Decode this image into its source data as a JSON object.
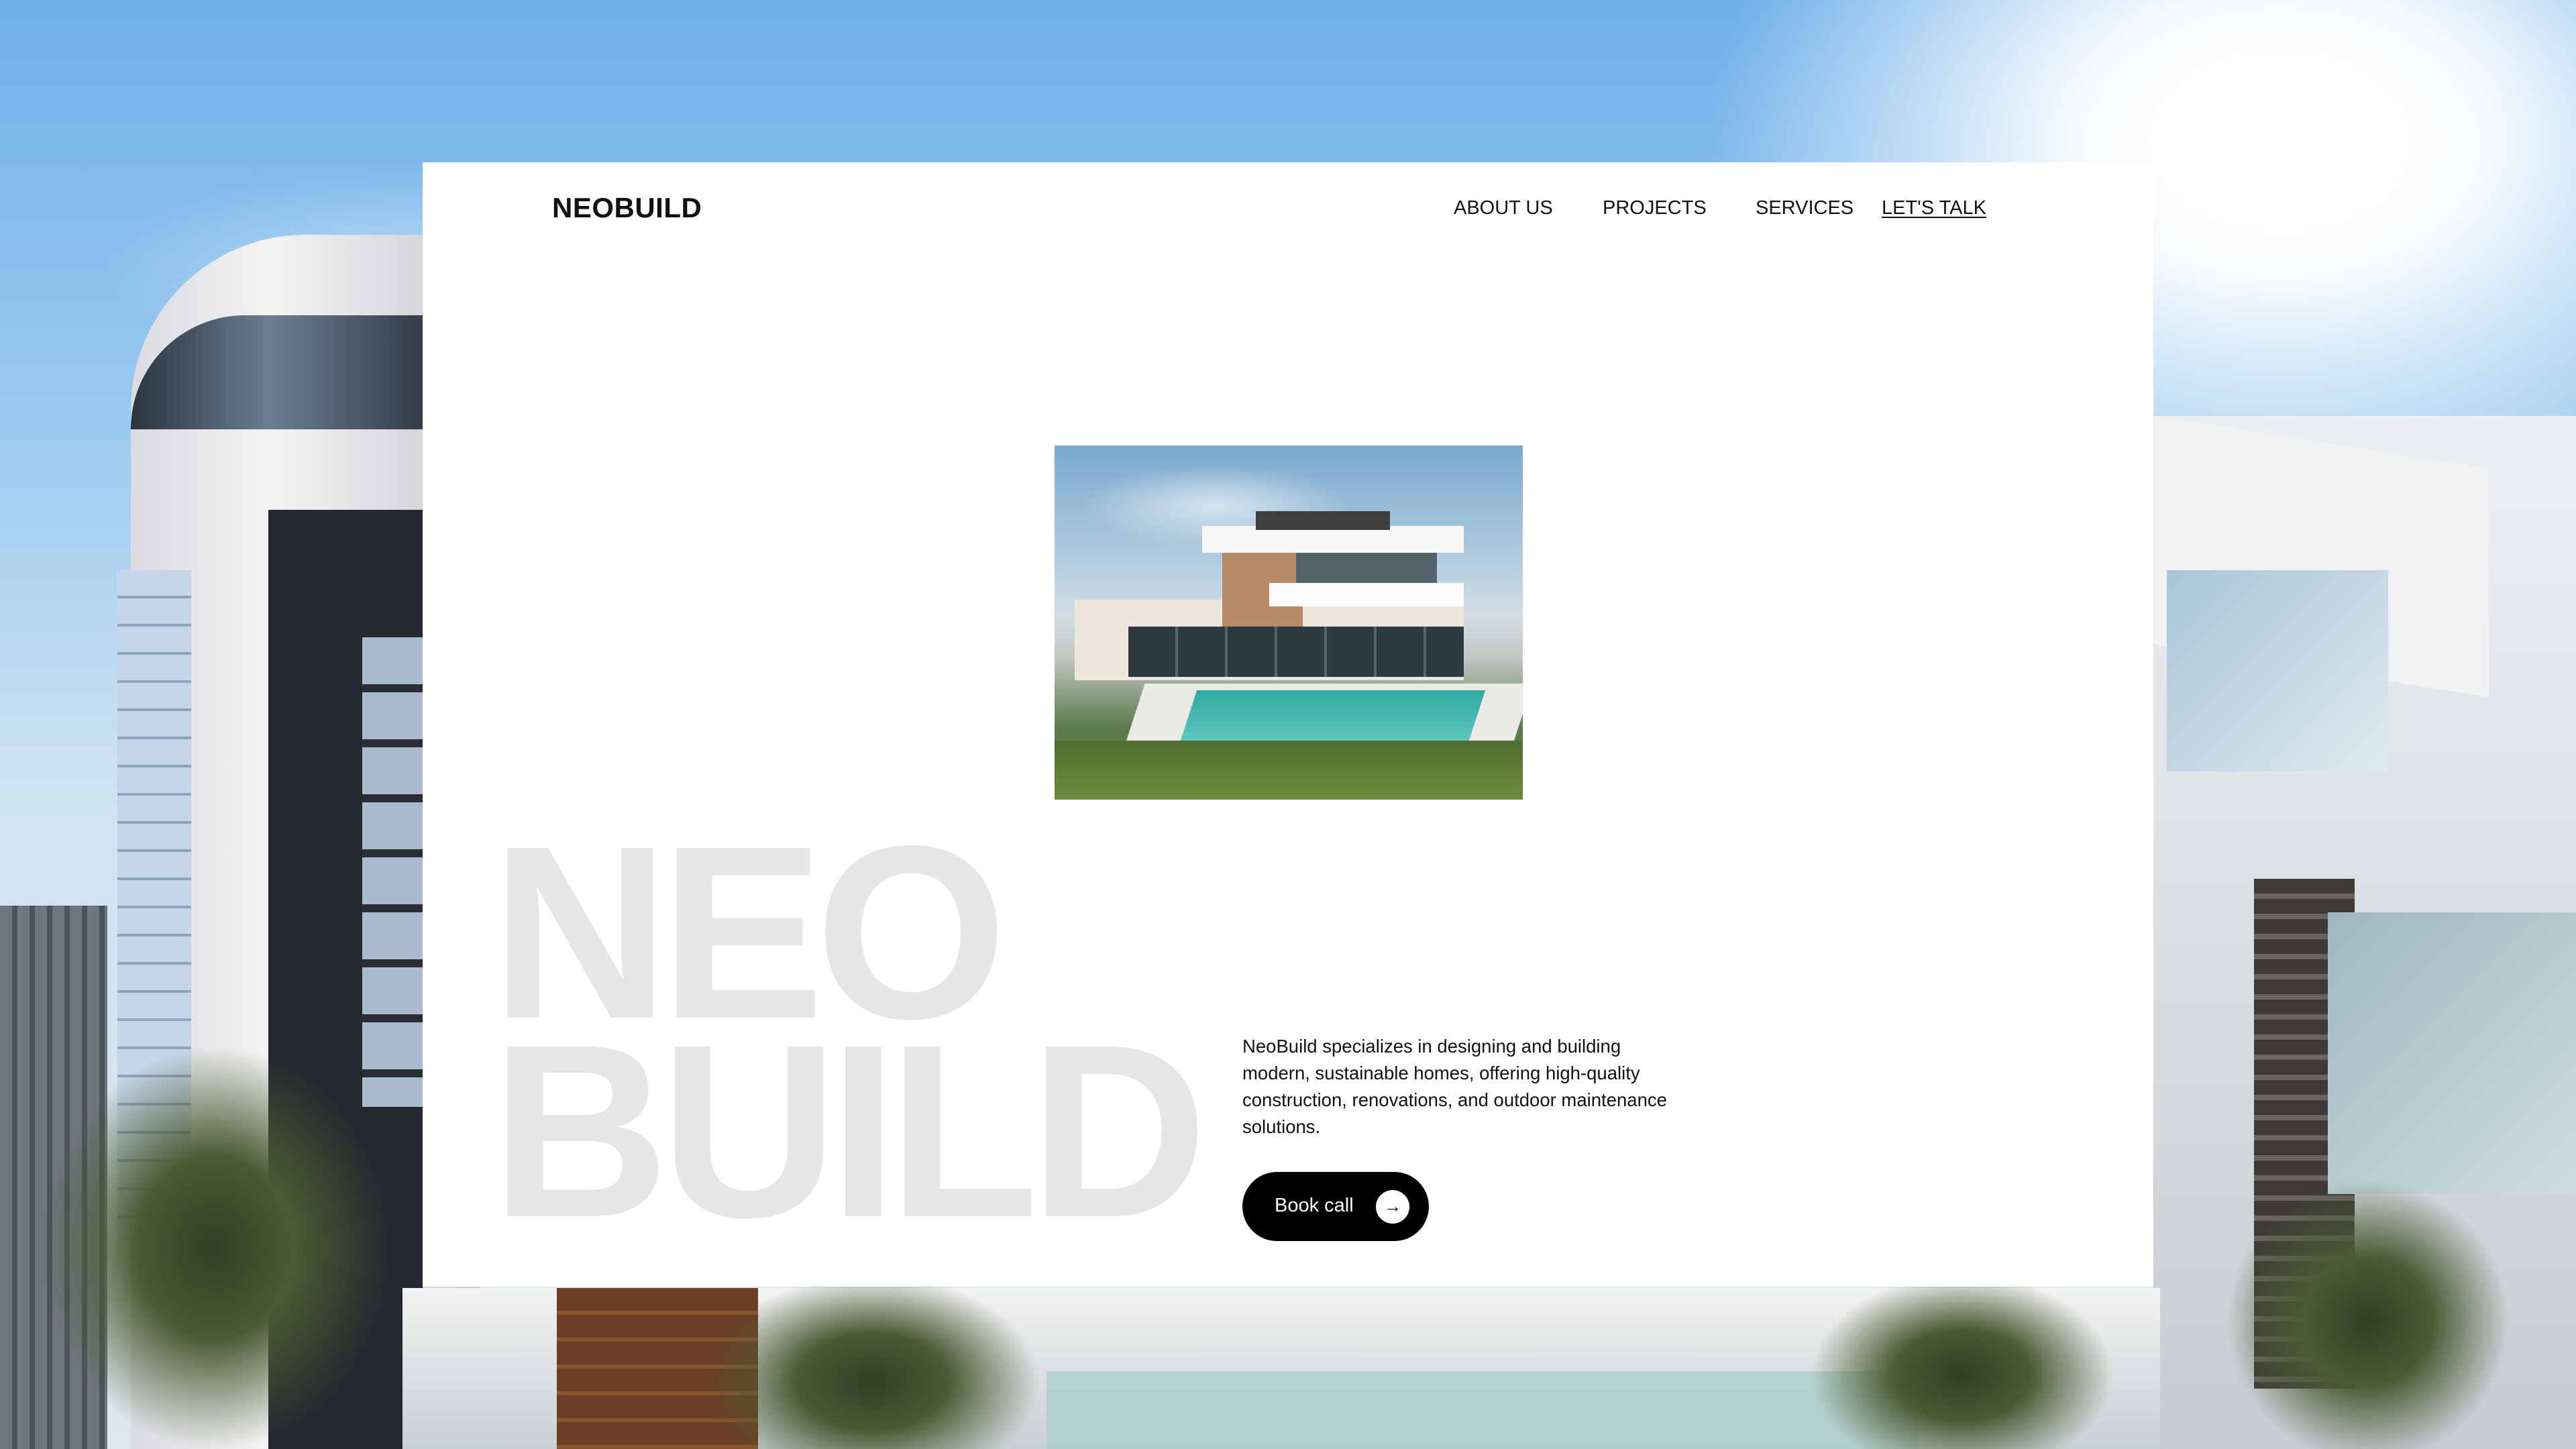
{
  "brand": {
    "logo_text": "NEOBUILD"
  },
  "nav": {
    "items": [
      {
        "label": "ABOUT US"
      },
      {
        "label": "PROJECTS"
      },
      {
        "label": "SERVICES"
      },
      {
        "label": "LET'S TALK"
      }
    ]
  },
  "hero": {
    "watermark_line1": "NEO",
    "watermark_line2": "BUILD",
    "description": "NeoBuild specializes in designing and building modern, sustainable homes, offering high-quality construction, renovations, and outdoor maintenance solutions.",
    "cta_label": "Book call",
    "cta_icon": "arrow-right-icon",
    "cta_icon_glyph": "→"
  },
  "colors": {
    "card_background": "#ffffff",
    "text_primary": "#111111",
    "watermark": "#e6e6e6",
    "button_background": "#000000",
    "button_text": "#ffffff"
  }
}
